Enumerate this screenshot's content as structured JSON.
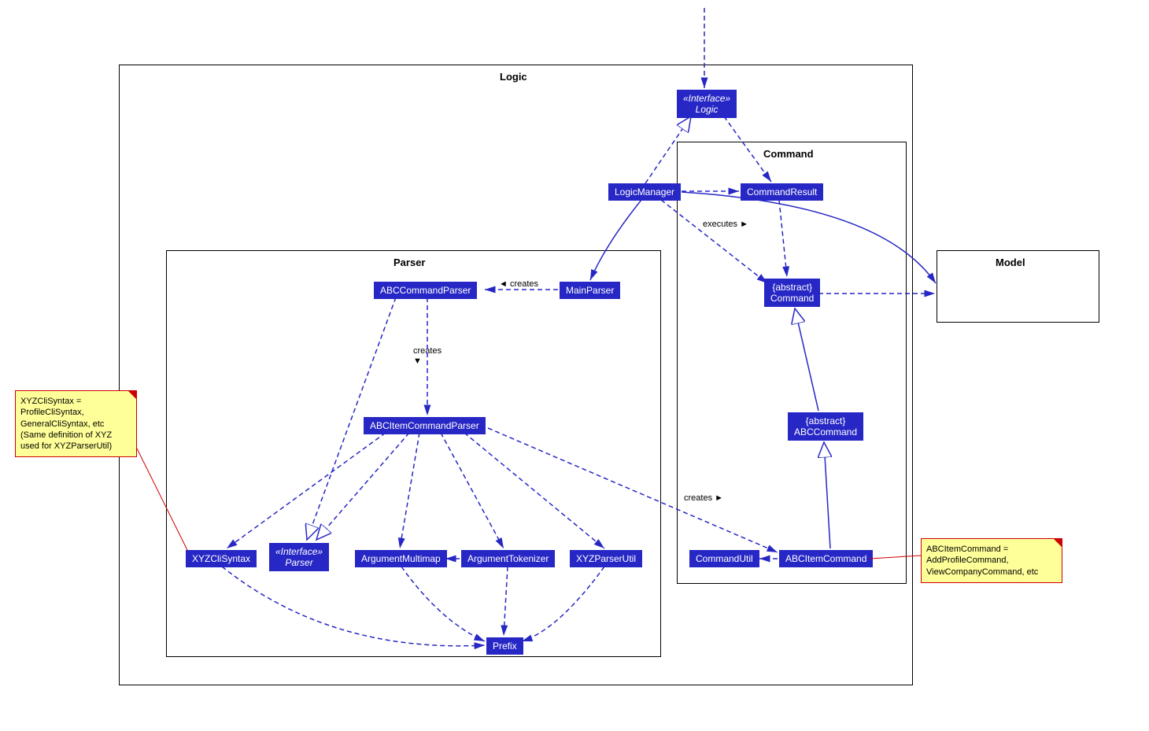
{
  "packages": {
    "logic": "Logic",
    "parser": "Parser",
    "command": "Command",
    "model": "Model"
  },
  "nodes": {
    "logic_interface": {
      "stereotype": "«Interface»",
      "name": "Logic"
    },
    "logic_manager": "LogicManager",
    "command_result": "CommandResult",
    "abstract_command": {
      "stereotype": "{abstract}",
      "name": "Command"
    },
    "abstract_abc_command": {
      "stereotype": "{abstract}",
      "name": "ABCCommand"
    },
    "command_util": "CommandUtil",
    "abc_item_command": "ABCItemCommand",
    "main_parser": "MainParser",
    "abc_command_parser": "ABCCommandParser",
    "abc_item_command_parser": "ABCItemCommandParser",
    "parser_interface": {
      "stereotype": "«Interface»",
      "name": "Parser"
    },
    "xyz_cli_syntax": "XYZCliSyntax",
    "argument_multimap": "ArgumentMultimap",
    "argument_tokenizer": "ArgumentTokenizer",
    "xyz_parser_util": "XYZParserUtil",
    "prefix": "Prefix"
  },
  "labels": {
    "creates1": "◄ creates",
    "creates2": "creates\n▼",
    "creates3": "creates ►",
    "executes": "executes ►"
  },
  "notes": {
    "note1": "XYZCliSyntax =\nProfileCliSyntax,\nGeneralCliSyntax, etc\n(Same definition of XYZ\nused for XYZParserUtil)",
    "note2": "ABCItemCommand =\nAddProfileCommand,\nViewCompanyCommand, etc"
  }
}
